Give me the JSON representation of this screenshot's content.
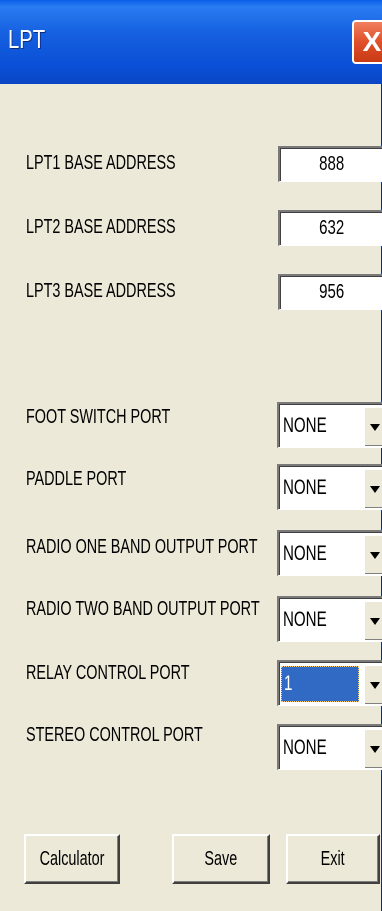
{
  "window": {
    "title": "LPT",
    "close_glyph": "X"
  },
  "addresses": [
    {
      "label": "LPT1 BASE ADDRESS",
      "value": "888"
    },
    {
      "label": "LPT2 BASE ADDRESS",
      "value": "632"
    },
    {
      "label": "LPT3 BASE ADDRESS",
      "value": "956"
    }
  ],
  "ports": [
    {
      "label": "FOOT SWITCH PORT",
      "value": "NONE",
      "selected": false
    },
    {
      "label": "PADDLE PORT",
      "value": "NONE",
      "selected": false
    },
    {
      "label": "RADIO ONE BAND OUTPUT PORT",
      "value": "NONE",
      "selected": false
    },
    {
      "label": "RADIO TWO BAND OUTPUT PORT",
      "value": "NONE",
      "selected": false
    },
    {
      "label": "RELAY CONTROL PORT",
      "value": "1",
      "selected": true
    },
    {
      "label": "STEREO CONTROL PORT",
      "value": "NONE",
      "selected": false
    }
  ],
  "buttons": {
    "calculator": "Calculator",
    "save": "Save",
    "exit": "Exit"
  },
  "colors": {
    "titlebar": "#0a4fd6",
    "close": "#e0502a",
    "selection": "#316ac5",
    "face": "#ece9d8"
  }
}
